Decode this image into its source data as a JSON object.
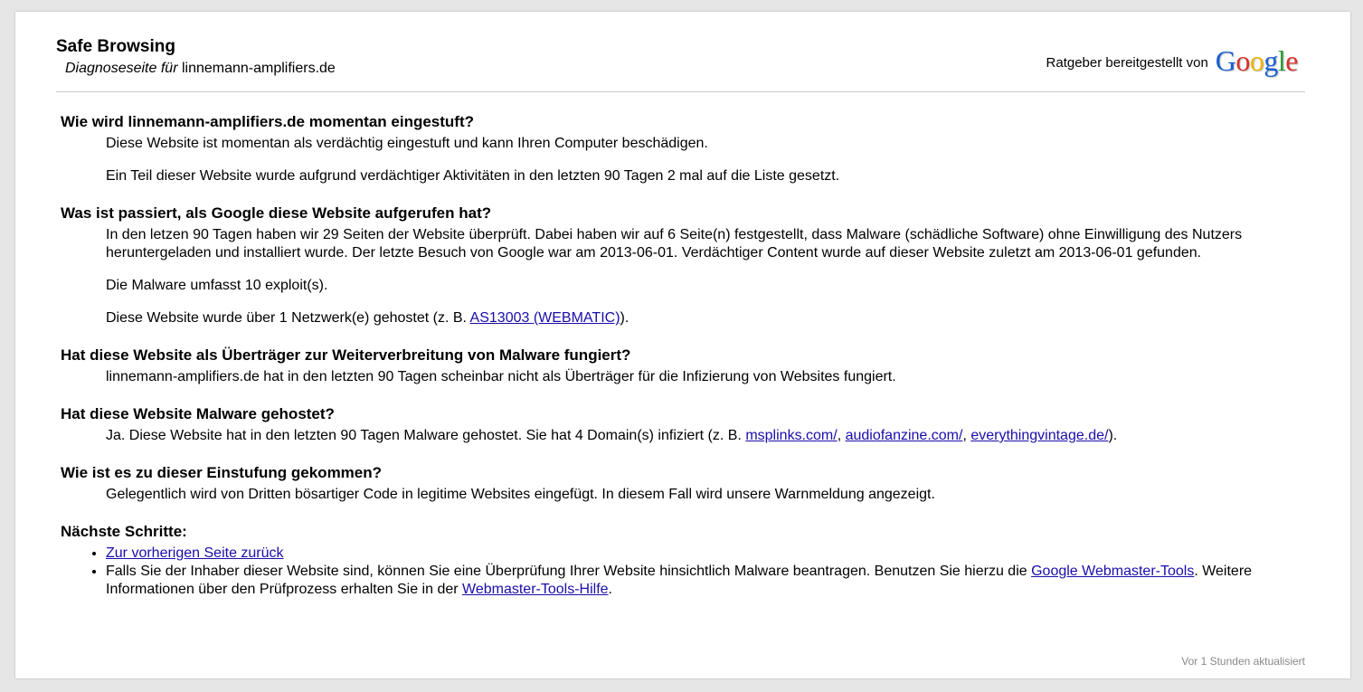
{
  "header": {
    "title": "Safe Browsing",
    "subtitle_prefix": "Diagnoseseite für",
    "domain": "linnemann-amplifiers.de",
    "provided_by": "Ratgeber bereitgestellt von",
    "logo_letters": [
      "G",
      "o",
      "o",
      "g",
      "l",
      "e"
    ]
  },
  "s1": {
    "heading": "Wie wird linnemann-amplifiers.de momentan eingestuft?",
    "p1": "Diese Website ist momentan als verdächtig eingestuft und kann Ihren Computer beschädigen.",
    "p2": "Ein Teil dieser Website wurde aufgrund verdächtiger Aktivitäten in den letzten 90 Tagen 2 mal auf die Liste gesetzt."
  },
  "s2": {
    "heading": "Was ist passiert, als Google diese Website aufgerufen hat?",
    "p1": "In den letzen 90 Tagen haben wir 29 Seiten der Website überprüft. Dabei haben wir auf 6 Seite(n) festgestellt, dass Malware (schädliche Software) ohne Einwilligung des Nutzers heruntergeladen und installiert wurde. Der letzte Besuch von Google war am 2013-06-01. Verdächtiger Content wurde auf dieser Website zuletzt am 2013-06-01 gefunden.",
    "p2": "Die Malware umfasst 10 exploit(s).",
    "p3_prefix": "Diese Website wurde über 1 Netzwerk(e) gehostet (z. B. ",
    "p3_link": "AS13003 (WEBMATIC)",
    "p3_suffix": ")."
  },
  "s3": {
    "heading": "Hat diese Website als Überträger zur Weiterverbreitung von Malware fungiert?",
    "p1": "linnemann-amplifiers.de hat in den letzten 90 Tagen scheinbar nicht als Überträger für die Infizierung von Websites fungiert."
  },
  "s4": {
    "heading": "Hat diese Website Malware gehostet?",
    "p1_prefix": "Ja. Diese Website hat in den letzten 90 Tagen Malware gehostet. Sie hat 4 Domain(s) infiziert (z. B. ",
    "link1": "msplinks.com/",
    "link2": "audiofanzine.com/",
    "link3": "everythingvintage.de/",
    "sep": ", ",
    "p1_suffix": ")."
  },
  "s5": {
    "heading": "Wie ist es zu dieser Einstufung gekommen?",
    "p1": "Gelegentlich wird von Dritten bösartiger Code in legitime Websites eingefügt. In diesem Fall wird unsere Warnmeldung angezeigt."
  },
  "s6": {
    "heading": "Nächste Schritte:",
    "item1_link": "Zur vorherigen Seite zurück",
    "item2_prefix": "Falls Sie der Inhaber dieser Website sind, können Sie eine Überprüfung Ihrer Website hinsichtlich Malware beantragen. Benutzen Sie hierzu die ",
    "item2_link1": "Google Webmaster-Tools",
    "item2_mid": ". Weitere Informationen über den Prüfprozess erhalten Sie in der ",
    "item2_link2": "Webmaster-Tools-Hilfe",
    "item2_suffix": "."
  },
  "footer": {
    "updated": "Vor 1 Stunden aktualisiert"
  }
}
